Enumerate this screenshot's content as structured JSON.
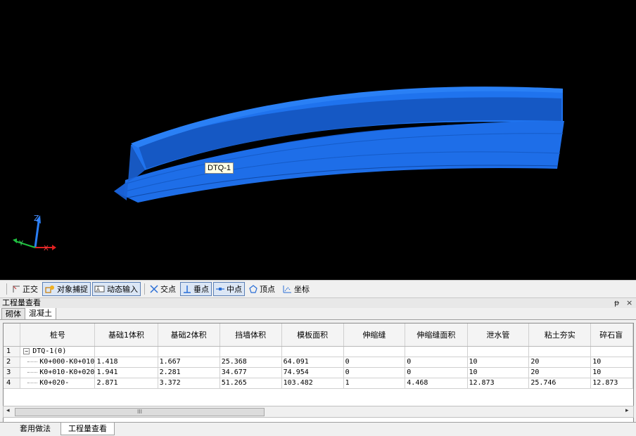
{
  "viewport": {
    "object_label": "DTQ-1",
    "background": "#000000",
    "object_color": "#1a6ce8"
  },
  "snap_toolbar": {
    "items": [
      {
        "label": "正交",
        "icon": "ortho-icon",
        "on": false
      },
      {
        "label": "对象捕捉",
        "icon": "snap-icon",
        "on": true
      },
      {
        "label": "动态输入",
        "icon": "dynamic-input-icon",
        "on": true
      },
      {
        "label": "交点",
        "icon": "intersection-icon",
        "on": false
      },
      {
        "label": "垂点",
        "icon": "perpendicular-icon",
        "on": true
      },
      {
        "label": "中点",
        "icon": "midpoint-icon",
        "on": true
      },
      {
        "label": "顶点",
        "icon": "vertex-icon",
        "on": false
      },
      {
        "label": "坐标",
        "icon": "coordinate-icon",
        "on": false
      }
    ]
  },
  "quantity_panel": {
    "title": "工程量查看",
    "pin_glyph": "ᵽ",
    "close_glyph": "×",
    "subtabs": [
      {
        "label": "砌体",
        "active": false
      },
      {
        "label": "混凝土",
        "active": true
      }
    ],
    "columns": [
      "桩号",
      "基础1体积",
      "基础2体积",
      "挡墙体积",
      "模板面积",
      "伸缩缝",
      "伸缩缝面积",
      "泄水管",
      "粘土夯实",
      "碎石盲"
    ],
    "rows": [
      {
        "num": "1",
        "expander": "−",
        "station": "DTQ-1(0)",
        "cells": [
          "",
          "",
          "",
          "",
          "",
          "",
          "",
          "",
          ""
        ]
      },
      {
        "num": "2",
        "station": "K0+000-K0+010",
        "cells": [
          "1.418",
          "1.667",
          "25.368",
          "64.091",
          "0",
          "0",
          "10",
          "20",
          "10"
        ]
      },
      {
        "num": "3",
        "station": "K0+010-K0+020",
        "cells": [
          "1.941",
          "2.281",
          "34.677",
          "74.954",
          "0",
          "0",
          "10",
          "20",
          "10"
        ]
      },
      {
        "num": "4",
        "station": "K0+020-",
        "cells": [
          "2.871",
          "3.372",
          "51.265",
          "103.482",
          "1",
          "4.468",
          "12.873",
          "25.746",
          "12.873"
        ]
      }
    ],
    "scroll_left": "◂",
    "scroll_right": "▸",
    "scroll_grip": "III"
  },
  "bottom_tabs": [
    {
      "label": "套用做法",
      "active": false
    },
    {
      "label": "工程量查看",
      "active": true
    }
  ],
  "axis": {
    "z": "Z",
    "x": "X",
    "y": "Y"
  }
}
